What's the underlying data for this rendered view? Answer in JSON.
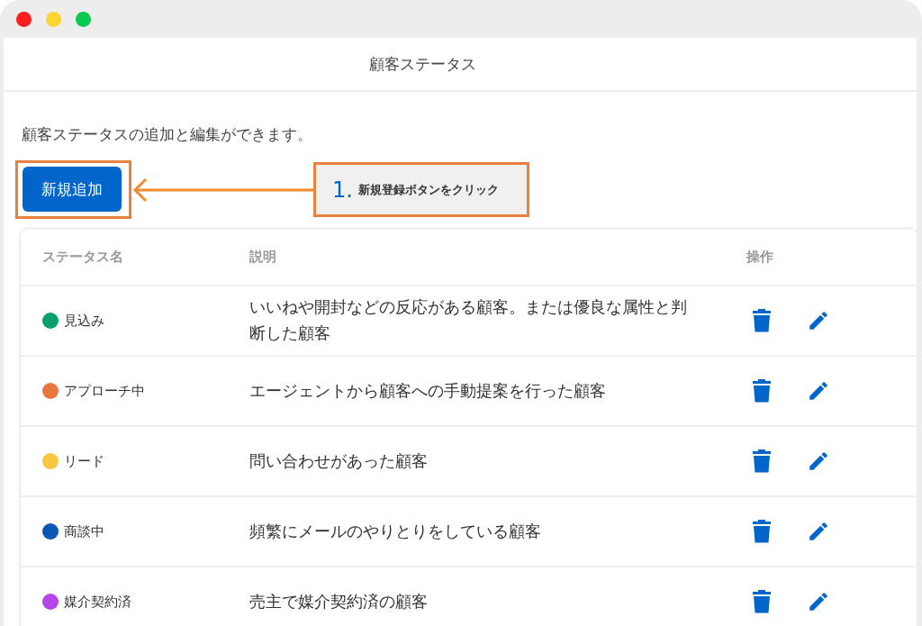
{
  "page": {
    "title": "顧客ステータス",
    "description": "顧客ステータスの追加と編集ができます。"
  },
  "add_button": {
    "label": "新規追加"
  },
  "annotation": {
    "step": "1.",
    "text": "新規登録ボタンをクリック"
  },
  "table": {
    "columns": [
      "ステータス名",
      "説明",
      "操作"
    ],
    "rows": [
      {
        "name": "見込み",
        "color": "#0aa06e",
        "description": "いいねや開封などの反応がある顧客。または優良な属性と判断した顧客"
      },
      {
        "name": "アプローチ中",
        "color": "#e8773f",
        "description": "エージェントから顧客への手動提案を行った顧客"
      },
      {
        "name": "リード",
        "color": "#f8c63f",
        "description": "問い合わせがあった顧客"
      },
      {
        "name": "商談中",
        "color": "#0a57b5",
        "description": "頻繁にメールのやりとりをしている顧客"
      },
      {
        "name": "媒介契約済",
        "color": "#b646e8",
        "description": "売主で媒介契約済の顧客"
      }
    ]
  }
}
